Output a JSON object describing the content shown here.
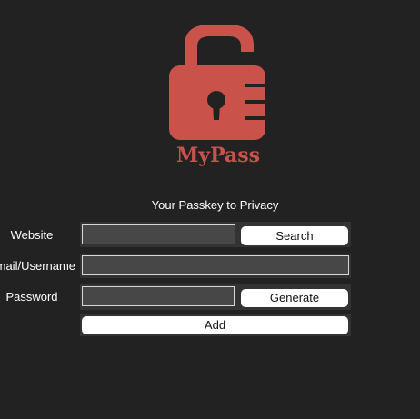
{
  "brand": {
    "name": "MyPass",
    "logo_icon": "unlocked-padlock-icon",
    "color": "#c9534a"
  },
  "tagline": "Your Passkey to Privacy",
  "form": {
    "website": {
      "label": "Website",
      "value": "",
      "button": "Search"
    },
    "email": {
      "label": "Email/Username",
      "value": ""
    },
    "password": {
      "label": "Password",
      "value": "",
      "button": "Generate"
    },
    "add_button": "Add"
  },
  "colors": {
    "background": "#222222",
    "row": "#333333",
    "input": "#474747",
    "button": "#ffffff"
  }
}
